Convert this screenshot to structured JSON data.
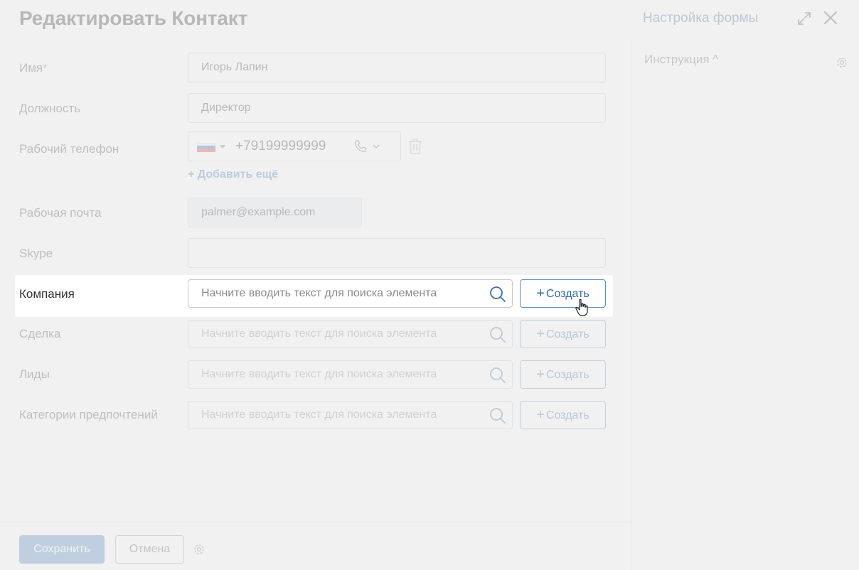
{
  "header": {
    "title": "Редактировать Контакт",
    "form_settings": "Настройка формы"
  },
  "right_panel": {
    "instruction": "Инструкция ^"
  },
  "form": {
    "name": {
      "label": "Имя",
      "required_mark": "*",
      "value": "Игорь Лапин"
    },
    "position": {
      "label": "Должность",
      "value": "Директор"
    },
    "work_phone": {
      "label": "Рабочий телефон",
      "value": "+79199999999",
      "add_more": "+ Добавить ещё"
    },
    "work_email": {
      "label": "Рабочая почта",
      "value": "palmer@example.com"
    },
    "skype": {
      "label": "Skype",
      "value": ""
    },
    "company": {
      "label": "Компания",
      "placeholder": "Начните вводить текст для поиска элемента",
      "create": "Создать"
    },
    "deal": {
      "label": "Сделка",
      "placeholder": "Начните вводить текст для поиска элемента",
      "create": "Создать"
    },
    "leads": {
      "label": "Лиды",
      "placeholder": "Начните вводить текст для поиска элемента",
      "create": "Создать"
    },
    "preferences": {
      "label": "Категории предпочтений",
      "placeholder": "Начните вводить текст для поиска элемента",
      "create": "Создать"
    }
  },
  "footer": {
    "save": "Сохранить",
    "cancel": "Отмена"
  },
  "colors": {
    "accent": "#2f6aa8",
    "save_button": "#4f84bd",
    "required": "#d9534f"
  },
  "icons": [
    "expand-icon",
    "close-icon",
    "gear-icon",
    "search-icon",
    "phone-icon",
    "trash-icon",
    "chevron-down-icon",
    "pointer-cursor-icon"
  ]
}
